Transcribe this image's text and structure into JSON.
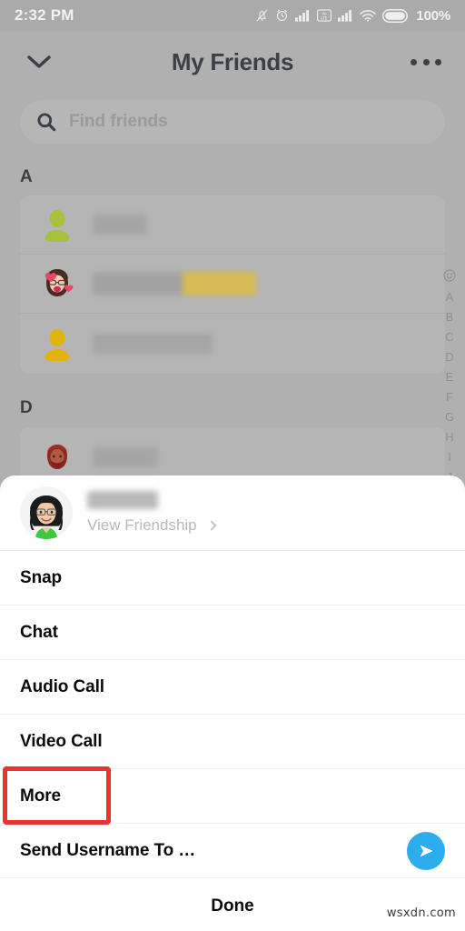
{
  "status_bar": {
    "time": "2:32 PM",
    "battery_percent": "100%",
    "icons": [
      "bell-muted-icon",
      "alarm-clock-icon",
      "signal-bars-icon",
      "volte-icon",
      "signal-bars-2-icon",
      "wifi-icon",
      "battery-icon"
    ]
  },
  "nav": {
    "back_icon": "chevron-down-icon",
    "title": "My Friends",
    "more_icon": "more-options-icon"
  },
  "search": {
    "icon": "search-icon",
    "value": "",
    "placeholder": "Find friends"
  },
  "sections": [
    {
      "letter": "A"
    },
    {
      "letter": "D"
    }
  ],
  "alpha_index": {
    "top_icon": "smiley-face-icon",
    "letters": [
      "A",
      "B",
      "C",
      "D",
      "E",
      "F",
      "G",
      "H",
      "I",
      "J"
    ]
  },
  "friends": [
    {
      "avatar": "green-person-avatar",
      "name_hidden": true
    },
    {
      "avatar": "bitmoji-hearts-avatar",
      "name_hidden": true
    },
    {
      "avatar": "yellow-person-avatar",
      "name_hidden": true
    },
    {
      "avatar": "bitmoji-beard-avatar",
      "name_hidden": true
    }
  ],
  "sheet": {
    "avatar": "bitmoji-glasses-green-avatar",
    "name_hidden": true,
    "view_friendship_label": "View Friendship",
    "view_friendship_chevron": "chevron-right-icon",
    "menu": [
      {
        "label": "Snap",
        "highlighted": false
      },
      {
        "label": "Chat",
        "highlighted": false
      },
      {
        "label": "Audio Call",
        "highlighted": false
      },
      {
        "label": "Video Call",
        "highlighted": false
      },
      {
        "label": "More",
        "highlighted": true
      },
      {
        "label": "Send Username To …",
        "highlighted": false,
        "trailing_icon": "send-arrow-icon"
      }
    ],
    "done_label": "Done"
  },
  "highlight": {
    "color": "#e8342c",
    "target": "More"
  },
  "watermark": "wsxdn.com",
  "colors": {
    "dim_background": "#b0b0b0",
    "sheet_background": "#ffffff",
    "send_button": "#2cadee",
    "highlight_red": "#e8342c",
    "title_text": "#3b3f46"
  }
}
